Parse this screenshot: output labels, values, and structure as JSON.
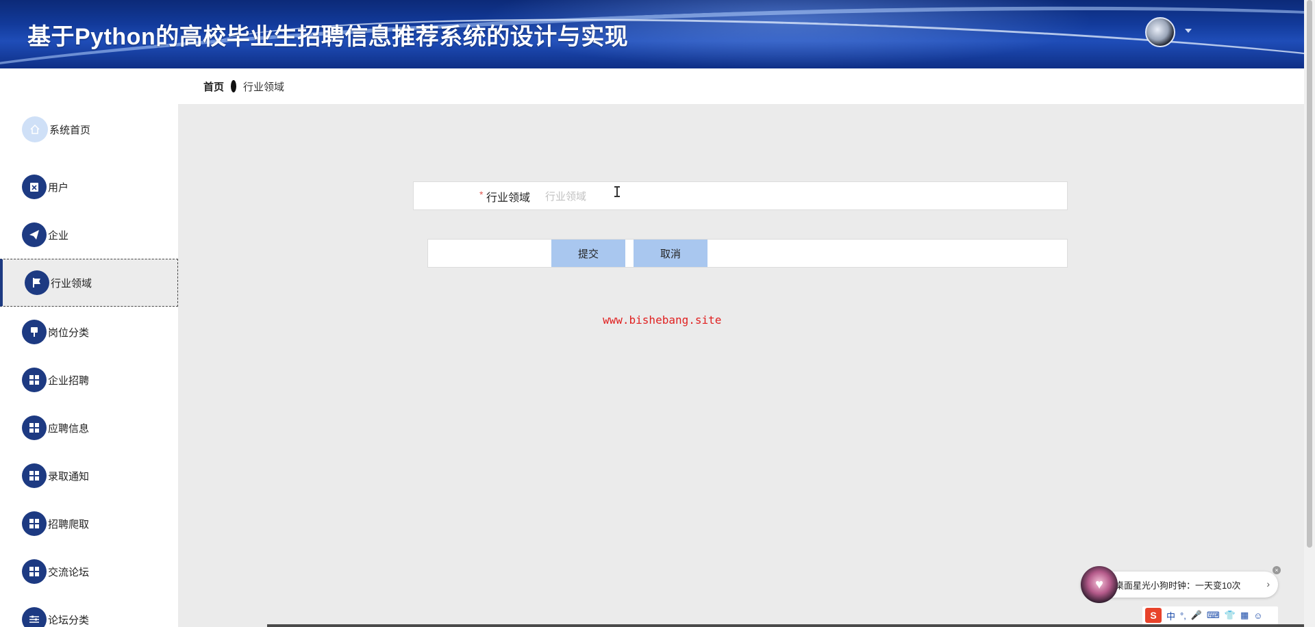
{
  "header": {
    "title": "基于Python的高校毕业生招聘信息推荐系统的设计与实现"
  },
  "breadcrumb": {
    "home": "首页",
    "current": "行业领域"
  },
  "sidebar": {
    "items": [
      {
        "label": "系统首页",
        "icon": "home-icon"
      },
      {
        "label": "用户",
        "icon": "clipboard-icon"
      },
      {
        "label": "企业",
        "icon": "paper-plane-icon"
      },
      {
        "label": "行业领域",
        "icon": "flag-icon",
        "active": true
      },
      {
        "label": "岗位分类",
        "icon": "pin-icon"
      },
      {
        "label": "企业招聘",
        "icon": "grid-icon"
      },
      {
        "label": "应聘信息",
        "icon": "grid-icon"
      },
      {
        "label": "录取通知",
        "icon": "grid-icon"
      },
      {
        "label": "招聘爬取",
        "icon": "grid-icon"
      },
      {
        "label": "交流论坛",
        "icon": "grid-icon"
      },
      {
        "label": "论坛分类",
        "icon": "sliders-icon"
      }
    ]
  },
  "form": {
    "required_mark": "*",
    "label": "行业领域",
    "placeholder": "行业领域",
    "value": ""
  },
  "actions": {
    "submit_label": "提交",
    "cancel_label": "取消"
  },
  "watermark": "www.bishebang.site",
  "notification": {
    "text": "桌面星光小狗时钟：一天变10次"
  },
  "ime": {
    "logo": "S",
    "mode": "中"
  },
  "colors": {
    "header_blue": "#123a9a",
    "sidebar_icon_bg": "#1d3a82",
    "button_bg": "#a9c7ef",
    "watermark_red": "#e02020",
    "required_red": "#e0564f"
  }
}
